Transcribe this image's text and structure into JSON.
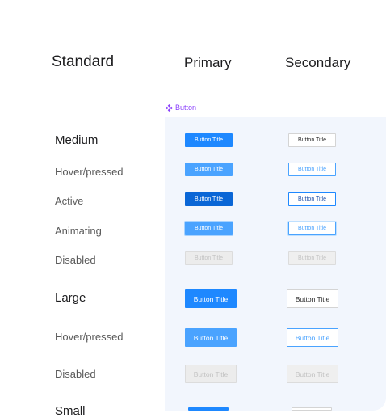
{
  "headers": {
    "standard": "Standard",
    "primary": "Primary",
    "secondary": "Secondary"
  },
  "component_tag": "Button",
  "colors": {
    "accent": "#1e88ff",
    "accent_hover": "#4aa3ff",
    "accent_active": "#0a66d6",
    "panel_bg": "#f2f6fd",
    "component_purple": "#8a3ffc"
  },
  "rows": {
    "medium": "Medium",
    "medium_hover": "Hover/pressed",
    "medium_active": "Active",
    "medium_animating": "Animating",
    "medium_disabled": "Disabled",
    "large": "Large",
    "large_hover": "Hover/pressed",
    "large_disabled": "Disabled",
    "small": "Small"
  },
  "button_label": "Button Title"
}
